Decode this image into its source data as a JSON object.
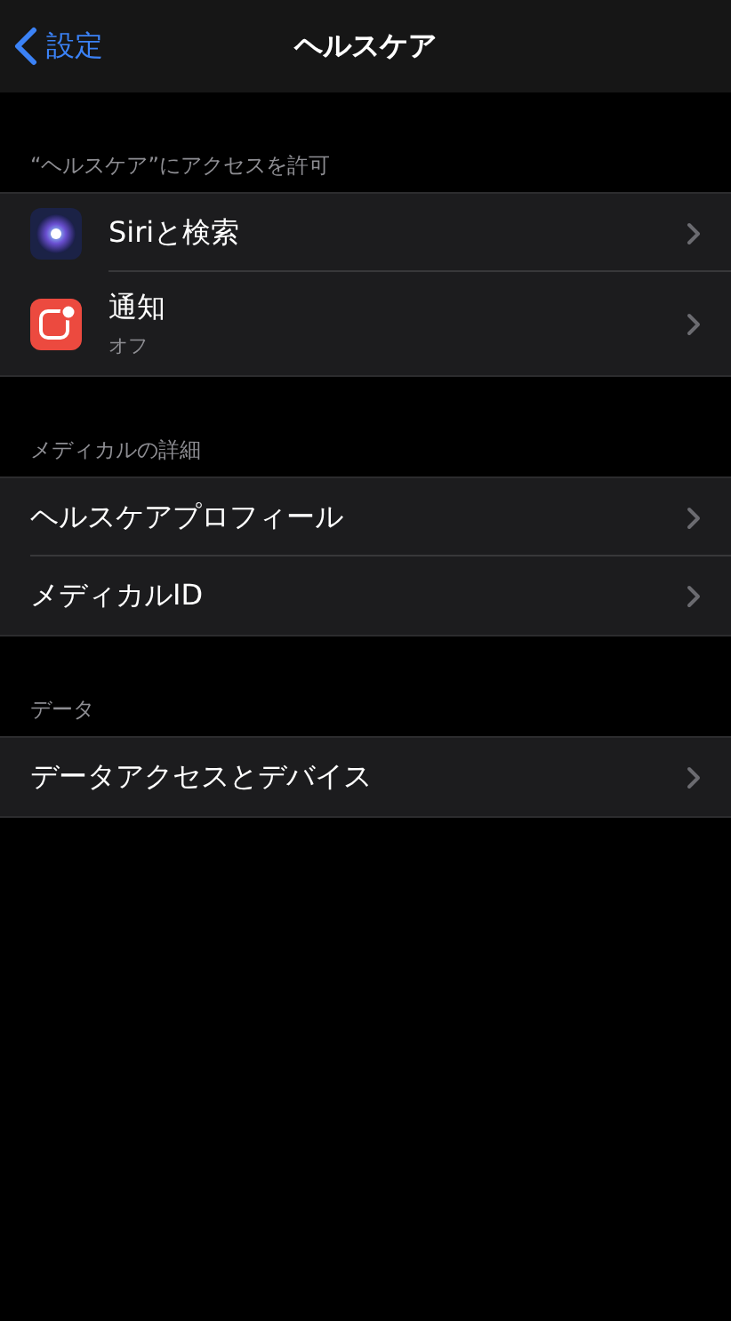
{
  "nav": {
    "back": "設定",
    "title": "ヘルスケア"
  },
  "sections": [
    {
      "header": "“ヘルスケア”にアクセスを許可",
      "items": [
        {
          "label": "Siriと検索",
          "kind": "siri"
        },
        {
          "label": "通知",
          "subtitle": "オフ",
          "kind": "notifications"
        }
      ]
    },
    {
      "header": "メディカルの詳細",
      "items": [
        {
          "label": "ヘルスケアプロフィール"
        },
        {
          "label": "メディカルID"
        }
      ]
    },
    {
      "header": "データ",
      "items": [
        {
          "label": "データアクセスとデバイス"
        }
      ]
    }
  ]
}
